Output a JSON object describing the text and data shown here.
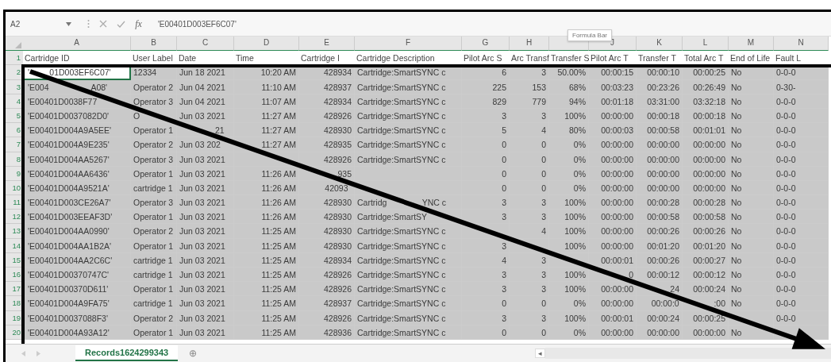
{
  "formula_bar": {
    "name_box": "A2",
    "fx": "fx",
    "formula": "'E00401D003EF6C07'"
  },
  "tooltip": "Formula Bar",
  "columns": [
    {
      "letter": "A",
      "header": "Cartridge ID",
      "kind": "text"
    },
    {
      "letter": "B",
      "header": "User Label",
      "kind": "text"
    },
    {
      "letter": "C",
      "header": "Date",
      "kind": "text"
    },
    {
      "letter": "D",
      "header": "Time",
      "kind": "number"
    },
    {
      "letter": "E",
      "header": "Cartridge I",
      "kind": "number"
    },
    {
      "letter": "F",
      "header": "Cartridge Description",
      "kind": "text"
    },
    {
      "letter": "G",
      "header": "Pilot Arc S",
      "kind": "number"
    },
    {
      "letter": "H",
      "header": "Arc Transf",
      "kind": "number"
    },
    {
      "header": "Transfer S",
      "kind": "number"
    },
    {
      "letter": "J",
      "header": "Pilot Arc T",
      "kind": "number"
    },
    {
      "letter": "K",
      "header": "Transfer T",
      "kind": "number"
    },
    {
      "letter": "L",
      "header": "Total Arc T",
      "kind": "number"
    },
    {
      "letter": "M",
      "header": "End of Life",
      "kind": "text"
    },
    {
      "letter": "N",
      "header": "Fault L",
      "kind": "text"
    }
  ],
  "header_row_number": "1",
  "rows": [
    {
      "number": "2",
      "selected": true,
      "cells": [
        {
          "before": "'",
          "after": "01D003EF6C07'"
        },
        "12334",
        "Jun 18 2021",
        "10:20 AM",
        "428934",
        "Cartridge:SmartSYNC c",
        "6",
        "3",
        "50.00%",
        "00:00:15",
        "00:00:10",
        "00:00:25",
        "No",
        "0-0-0"
      ]
    },
    {
      "number": "3",
      "selected": true,
      "cells": [
        {
          "before": "'E004",
          "after": "A08'"
        },
        "Operator 2",
        "Jun 04 2021",
        "11:10 AM",
        "428937",
        "Cartridge:SmartSYNC c",
        "225",
        "153",
        "68%",
        "00:03:23",
        "00:23:26",
        "00:26:49",
        "No",
        "0-30-"
      ]
    },
    {
      "number": "4",
      "selected": true,
      "cells": [
        "'E00401D0038F77",
        "Operator 3",
        "Jun 04 2021",
        "11:07 AM",
        "428934",
        "Cartridge:SmartSYNC c",
        "829",
        "779",
        "94%",
        "00:01:18",
        "03:31:00",
        "03:32:18",
        "No",
        "0-0-0"
      ]
    },
    {
      "number": "5",
      "selected": true,
      "cells": [
        "'E00401D0037082D0'",
        {
          "before": "O"
        },
        "Jun 03 2021",
        "11:27 AM",
        "428926",
        "Cartridge:SmartSYNC c",
        "3",
        "3",
        "100%",
        "00:00:00",
        "00:00:18",
        "00:00:18",
        "No",
        "0-0-0"
      ]
    },
    {
      "number": "6",
      "selected": true,
      "cells": [
        "'E00401D004A9A5EE'",
        "Operator 1",
        {
          "after": "21"
        },
        "11:27 AM",
        "428930",
        "Cartridge:SmartSYNC c",
        "5",
        "4",
        "80%",
        "00:00:03",
        "00:00:58",
        "00:01:01",
        "No",
        "0-0-0"
      ]
    },
    {
      "number": "7",
      "selected": true,
      "cells": [
        "'E00401D004A9E235'",
        "Operator 2",
        {
          "before": "Jun 03 202"
        },
        "11:27 AM",
        "428935",
        "Cartridge:SmartSYNC c",
        "0",
        "0",
        "0%",
        "00:00:00",
        "00:00:00",
        "00:00:00",
        "No",
        "0-0-0"
      ]
    },
    {
      "number": "8",
      "selected": true,
      "cells": [
        "'E00401D004AA5267'",
        "Operator 3",
        "Jun 03 2021",
        null,
        "428926",
        "Cartridge:SmartSYNC c",
        "0",
        "0",
        "0%",
        "00:00:00",
        "00:00:00",
        "00:00:00",
        "No",
        "0-0-0"
      ]
    },
    {
      "number": "9",
      "selected": true,
      "cells": [
        "'E00401D004AA6436'",
        "Operator 1",
        "Jun 03 2021",
        "11:26 AM",
        {
          "after": "935"
        },
        null,
        "0",
        "0",
        "0%",
        "00:00:00",
        "00:00:00",
        "00:00:00",
        "No",
        "0-0-0"
      ]
    },
    {
      "number": "10",
      "selected": true,
      "cells": [
        "'E00401D004A9521A'",
        "cartridge 1",
        "Jun 03 2021",
        "11:26 AM",
        {
          "before": "42093"
        },
        null,
        "0",
        "0",
        "0%",
        "00:00:00",
        "00:00:00",
        "00:00:00",
        "No",
        "0-0-0"
      ]
    },
    {
      "number": "11",
      "selected": true,
      "cells": [
        "'E00401D003CE26A7'",
        "Operator 3",
        "Jun 03 2021",
        "11:26 AM",
        "428930",
        {
          "before": "Cartridg",
          "after": "YNC c"
        },
        "3",
        "3",
        "100%",
        "00:00:00",
        "00:00:28",
        "00:00:28",
        "No",
        "0-0-0"
      ]
    },
    {
      "number": "12",
      "selected": true,
      "cells": [
        "'E00401D003EEAF3D'",
        "Operator 1",
        "Jun 03 2021",
        "11:26 AM",
        "428930",
        {
          "before": "Cartridge:SmartSY"
        },
        "3",
        "3",
        "100%",
        "00:00:00",
        "00:00:58",
        "00:00:58",
        "No",
        "0-0-0"
      ]
    },
    {
      "number": "13",
      "selected": true,
      "cells": [
        "'E00401D004AA0990'",
        "Operator 2",
        "Jun 03 2021",
        "11:25 AM",
        "428930",
        "Cartridge:SmartSYNC c",
        null,
        "4",
        "100%",
        "00:00:00",
        "00:00:26",
        "00:00:26",
        "No",
        "0-0-0"
      ]
    },
    {
      "number": "14",
      "selected": true,
      "cells": [
        "'E00401D004AA1B2A'",
        "Operator 1",
        "Jun 03 2021",
        "11:25 AM",
        "428930",
        "Cartridge:SmartSYNC c",
        "3",
        null,
        "100%",
        "00:00:00",
        "00:01:20",
        "00:01:20",
        "No",
        "0-0-0"
      ]
    },
    {
      "number": "15",
      "selected": true,
      "cells": [
        "'E00401D004AA2C6C'",
        "cartridge 1",
        "Jun 03 2021",
        "11:25 AM",
        "428934",
        "Cartridge:SmartSYNC c",
        "4",
        "3",
        null,
        "00:00:01",
        "00:00:26",
        "00:00:27",
        "No",
        "0-0-0"
      ]
    },
    {
      "number": "16",
      "selected": true,
      "cells": [
        "'E00401D00370747C'",
        "cartridge 1",
        "Jun 03 2021",
        "11:25 AM",
        "428926",
        "Cartridge:SmartSYNC c",
        "3",
        "3",
        "100%",
        {
          "after": "0"
        },
        "00:00:12",
        "00:00:12",
        "No",
        "0-0-0"
      ]
    },
    {
      "number": "17",
      "selected": true,
      "cells": [
        "'E00401D00370D611'",
        "Operator 1",
        "Jun 03 2021",
        "11:25 AM",
        "428926",
        "Cartridge:SmartSYNC c",
        "3",
        "3",
        "100%",
        "00:00:00",
        {
          "after": "24"
        },
        "00:00:24",
        "No",
        "0-0-0"
      ]
    },
    {
      "number": "18",
      "selected": true,
      "cells": [
        "'E00401D004A9FA75'",
        "cartridge 1",
        "Jun 03 2021",
        "11:25 AM",
        "428937",
        "Cartridge:SmartSYNC c",
        "0",
        "0",
        "0%",
        "00:00:00",
        {
          "before": "00:00:0"
        },
        {
          "after": ":00"
        },
        "No",
        "0-0-0"
      ]
    },
    {
      "number": "19",
      "selected": true,
      "cells": [
        "'E00401D0037088F3'",
        "Operator 2",
        "Jun 03 2021",
        "11:25 AM",
        "428926",
        "Cartridge:SmartSYNC c",
        "3",
        "3",
        "100%",
        "00:00:01",
        "00:00:24",
        "00:00:25",
        null,
        "0-0-0"
      ]
    },
    {
      "number": "20",
      "selected": true,
      "cells": [
        "'E00401D004A93A12'",
        "Operator 1",
        "Jun 03 2021",
        "11:25 AM",
        "428936",
        "Cartridge:SmartSYNC c",
        "0",
        "0",
        "0%",
        "00:00:00",
        "00:00:00",
        "00:00:00",
        "No",
        null
      ]
    }
  ],
  "sheet_tabs": [
    {
      "label": "Records1624299343",
      "selected": true
    }
  ],
  "new_sheet": "⊕",
  "scroll_left": "◂"
}
